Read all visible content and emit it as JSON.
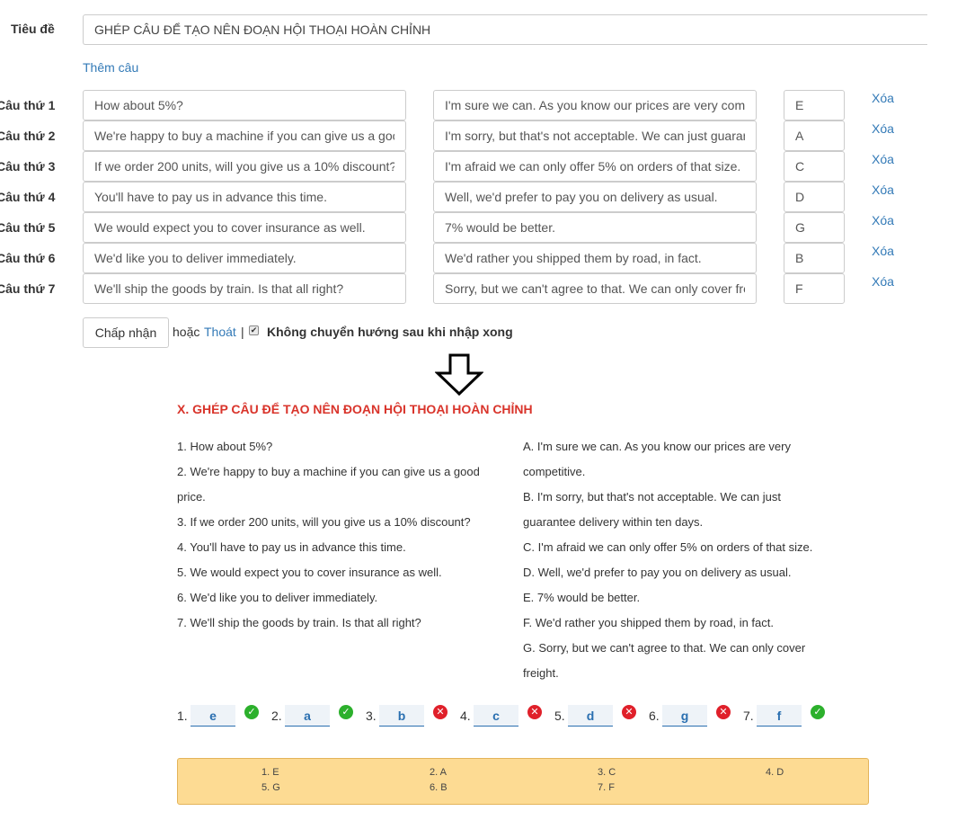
{
  "form": {
    "title_label": "Tiêu đề",
    "title_value": "GHÉP CÂU ĐỂ TẠO NÊN ĐOẠN HỘI THOẠI HOÀN CHỈNH",
    "add_link": "Thêm câu",
    "rows": [
      {
        "label": "Câu thứ 1",
        "question": "How about 5%?",
        "answer": "I'm sure we can. As you know our prices are very competitive.",
        "key": "E",
        "delete": "Xóa"
      },
      {
        "label": "Câu thứ 2",
        "question": "We're happy to buy a machine if you can give us a good price.",
        "answer": "I'm sorry, but that's not acceptable. We can just guarantee delivery within ten days.",
        "key": "A",
        "delete": "Xóa"
      },
      {
        "label": "Câu thứ 3",
        "question": "If we order 200 units, will you give us a 10% discount?",
        "answer": "I'm afraid we can only offer 5% on orders of that size.",
        "key": "C",
        "delete": "Xóa"
      },
      {
        "label": "Câu thứ 4",
        "question": "You'll have to pay us in advance this time.",
        "answer": "Well, we'd prefer to pay you on delivery as usual.",
        "key": "D",
        "delete": "Xóa"
      },
      {
        "label": "Câu thứ 5",
        "question": "We would expect you to cover insurance as well.",
        "answer": "7% would be better.",
        "key": "G",
        "delete": "Xóa"
      },
      {
        "label": "Câu thứ 6",
        "question": "We'd like you to deliver immediately.",
        "answer": "We'd rather you shipped them by road, in fact.",
        "key": "B",
        "delete": "Xóa"
      },
      {
        "label": "Câu thứ 7",
        "question": "We'll ship the goods by train. Is that all right?",
        "answer": "Sorry, but we can't agree to that. We can only cover freight.",
        "key": "F",
        "delete": "Xóa"
      }
    ],
    "accept_button": "Chấp nhận",
    "or_text": "hoặc",
    "exit_link": "Thoát",
    "separator": "|",
    "checkbox_checked": true,
    "checkbox_label": "Không chuyển hướng sau khi nhập xong"
  },
  "exercise": {
    "title": "X. GHÉP CÂU ĐỂ TẠO NÊN ĐOẠN HỘI THOẠI HOÀN CHỈNH",
    "left_lines": [
      "1. How about 5%?",
      "2. We're happy to buy a machine if you can give us a good",
      "price.",
      "3. If we order 200 units, will you give us a 10% discount?",
      "4. You'll have to pay us in advance this time.",
      "5. We would expect you to cover insurance as well.",
      "6. We'd like you to deliver immediately.",
      "7. We'll ship the goods by train. Is that all right?"
    ],
    "right_lines": [
      "A. I'm sure we can. As you know our prices are very",
      "competitive.",
      "B. I'm sorry, but that's not acceptable. We can just",
      "guarantee delivery within ten days.",
      "C. I'm afraid we can only offer 5% on orders of that size.",
      "D. Well, we'd prefer to pay you on delivery as usual.",
      "E. 7% would be better.",
      "F. We'd rather you shipped them by road, in fact.",
      "G. Sorry, but we can't agree to that. We can only cover",
      "freight."
    ],
    "answers": [
      {
        "num": "1.",
        "value": "e",
        "correct": true
      },
      {
        "num": "2.",
        "value": "a",
        "correct": true
      },
      {
        "num": "3.",
        "value": "b",
        "correct": false
      },
      {
        "num": "4.",
        "value": "c",
        "correct": false
      },
      {
        "num": "5.",
        "value": "d",
        "correct": false
      },
      {
        "num": "6.",
        "value": "g",
        "correct": false
      },
      {
        "num": "7.",
        "value": "f",
        "correct": true
      }
    ],
    "key": [
      "1. E",
      "2. A",
      "3. C",
      "4. D",
      "5. G",
      "6. B",
      "7. F"
    ]
  },
  "colors": {
    "link": "#337ab7",
    "title_red": "#d9342b",
    "correct": "#2cb02c",
    "wrong": "#e0202a",
    "key_bg": "#fddb93"
  },
  "icons": {
    "arrow": "down-arrow-icon",
    "correct": "check-circle-icon",
    "wrong": "x-circle-icon",
    "checkbox": "checkbox-icon"
  }
}
